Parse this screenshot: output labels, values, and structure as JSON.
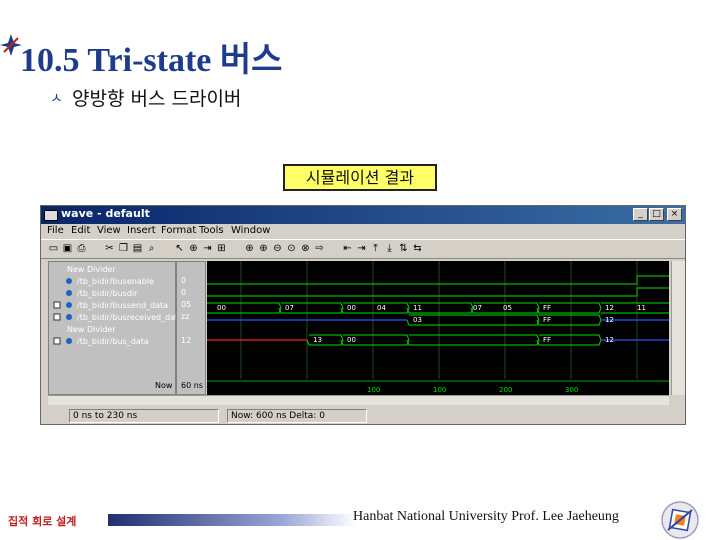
{
  "slide": {
    "title": "10.5 Tri-state 버스",
    "bullet": "ㅅ",
    "subtitle": "양방향 버스 드라이버",
    "caption": "시뮬레이션 결과",
    "footer_left": "집적 회로 설계",
    "footer_right": "Hanbat National University Prof. Lee Jaeheung"
  },
  "window": {
    "title": "wave - default",
    "menu": [
      "File",
      "Edit",
      "View",
      "Insert",
      "Format",
      "Tools",
      "Window"
    ],
    "min_label": "_",
    "max_label": "□",
    "close_label": "×",
    "signals": [
      {
        "name": "New Divider",
        "value": ""
      },
      {
        "name": "/tb_bidir/busenable",
        "value": "0"
      },
      {
        "name": "/tb_bidir/busdir",
        "value": "0"
      },
      {
        "name": "/tb_bidir/bussend_data",
        "value": "05"
      },
      {
        "name": "/tb_bidir/busreceived_data",
        "value": "zz"
      },
      {
        "name": "New Divider",
        "value": ""
      },
      {
        "name": "/tb_bidir/bus_data",
        "value": "12"
      }
    ],
    "cursor": {
      "label": "Now",
      "value": "60 ns"
    },
    "time_ticks": [
      "100",
      "100",
      "200",
      "300"
    ],
    "wave_labels": [
      "00",
      "07",
      "00",
      "04",
      "11",
      "07",
      "05",
      "FF",
      "12",
      "11",
      "03",
      "12",
      "FF",
      "13",
      "FF",
      "00",
      "12"
    ],
    "status": {
      "range": "0 ns to 230 ns",
      "now": "Now: 600 ns   Delta: 0"
    }
  }
}
